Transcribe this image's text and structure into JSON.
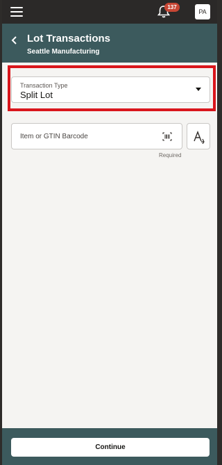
{
  "topbar": {
    "menu_icon": "hamburger-menu-icon",
    "notifications_icon": "bell-icon",
    "notifications_count": "137",
    "avatar_initials": "PA"
  },
  "header": {
    "back_icon": "chevron-left-icon",
    "title": "Lot Transactions",
    "subtitle": "Seattle Manufacturing"
  },
  "form": {
    "transaction_type": {
      "label": "Transaction Type",
      "value": "Split Lot"
    },
    "item": {
      "placeholder": "Item or GTIN Barcode",
      "value": "",
      "barcode_icon": "barcode-scan-icon",
      "helper": "Required"
    },
    "text_mode_icon": "text-cursor-icon"
  },
  "footer": {
    "continue_label": "Continue"
  },
  "colors": {
    "header_bg": "#3c5a5d",
    "topbar_bg": "#2b2928",
    "badge": "#c74634",
    "highlight": "#d9161c"
  }
}
